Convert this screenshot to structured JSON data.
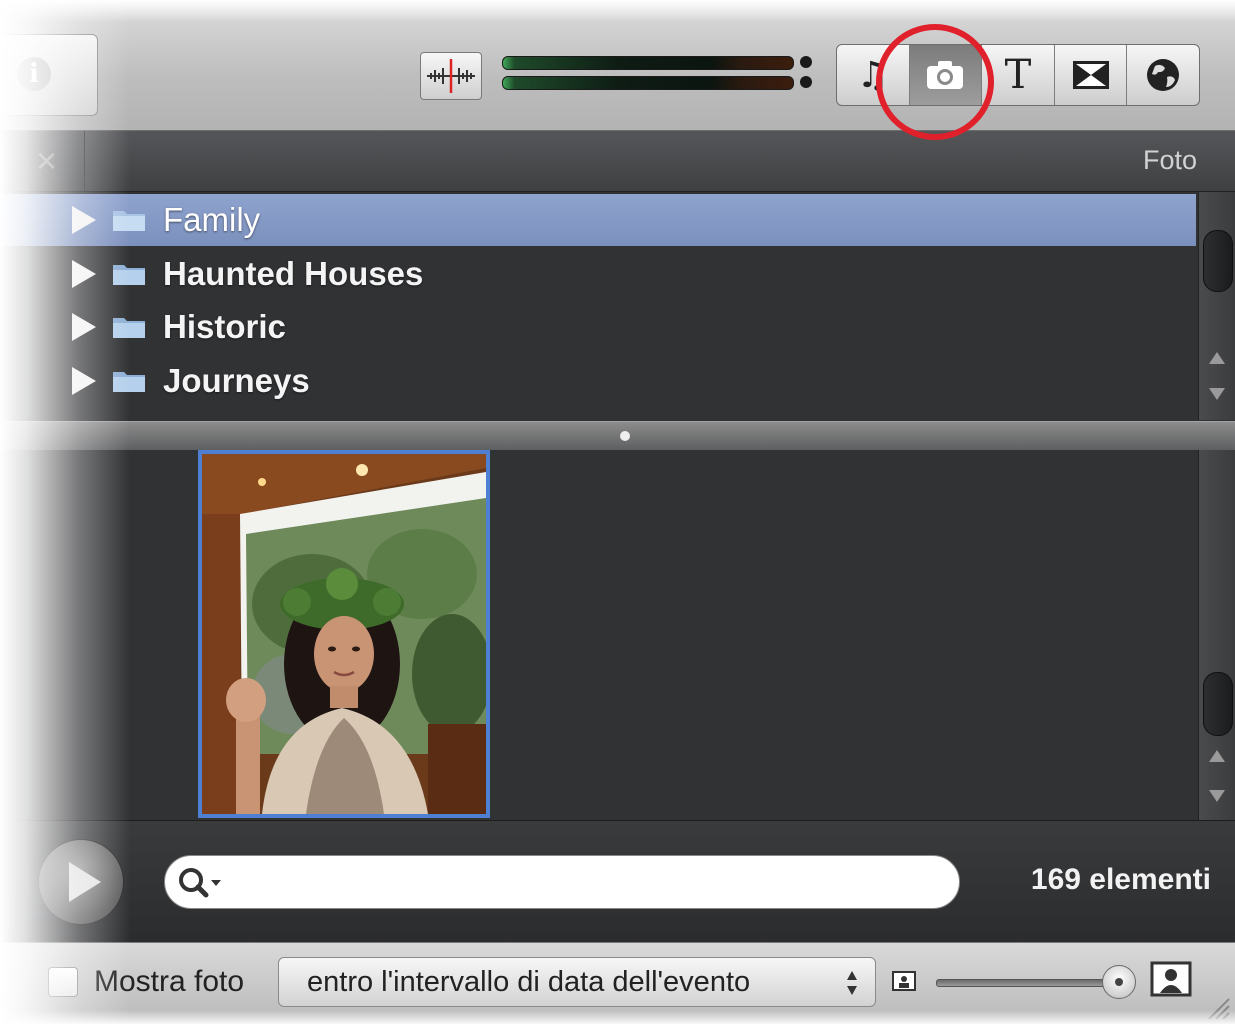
{
  "toolbar": {
    "info_icon": "info-icon",
    "audio_icon": "audio-waveform-icon",
    "buttons": [
      {
        "name": "music",
        "icon": "music-note-icon",
        "label": "♫"
      },
      {
        "name": "photos",
        "icon": "camera-icon",
        "active": true
      },
      {
        "name": "titles",
        "icon": "title-t-icon",
        "label": "T"
      },
      {
        "name": "transitions",
        "icon": "transition-icon"
      },
      {
        "name": "maps",
        "icon": "globe-icon"
      }
    ],
    "highlight_color": "#e0202a"
  },
  "header": {
    "close_icon": "close-icon",
    "close_glyph": "×",
    "title": "Foto"
  },
  "folders": [
    {
      "label": "Family",
      "selected": true
    },
    {
      "label": "Haunted Houses",
      "selected": false
    },
    {
      "label": "Historic",
      "selected": false
    },
    {
      "label": "Journeys",
      "selected": false
    }
  ],
  "search": {
    "placeholder": "",
    "value": "",
    "icon": "search-icon"
  },
  "status": {
    "count_text": "169 elementi"
  },
  "bottom": {
    "show_photos_label": "Mostra foto",
    "show_photos_checked": false,
    "date_range_option": "entro l'intervallo di data dell'evento",
    "thumbnail_size": 0.9
  },
  "colors": {
    "selection": "#8fa3cf",
    "thumb_border": "#4f7fd2",
    "panel_bg": "#313234"
  }
}
